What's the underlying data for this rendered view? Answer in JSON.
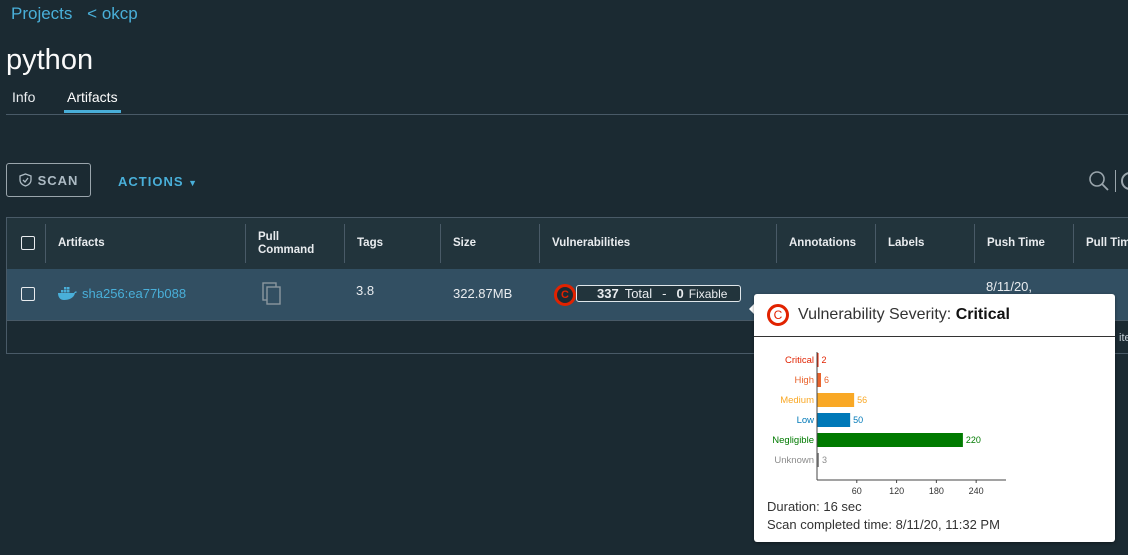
{
  "breadcrumb": {
    "project": "Projects",
    "current": "okcp"
  },
  "page": {
    "title": "python"
  },
  "tabs": [
    {
      "label": "Info"
    },
    {
      "label": "Artifacts"
    }
  ],
  "toolbar": {
    "scan_label": "SCAN",
    "actions_label": "ACTIONS"
  },
  "table": {
    "columns": [
      "Artifacts",
      "Pull Command",
      "Tags",
      "Size",
      "Vulnerabilities",
      "Annotations",
      "Labels",
      "Push Time",
      "Pull Tim"
    ],
    "rows": [
      {
        "digest": "sha256:ea77b088",
        "tags": "3.8",
        "size": "322.87MB",
        "severity_letter": "C",
        "vuln_total": "337",
        "vuln_total_label": "Total",
        "vuln_sep": "-",
        "vuln_fixable": "0",
        "vuln_fixable_label": "Fixable",
        "push_time": "8/11/20,"
      }
    ],
    "footer_fragment": "ite"
  },
  "popover": {
    "title_prefix": "Vulnerability Severity:",
    "title_value": "Critical",
    "badge": "C",
    "duration": "Duration: 16 sec",
    "completed": "Scan completed time: 8/11/20, 11:32 PM"
  },
  "chart_data": {
    "type": "bar",
    "orientation": "horizontal",
    "categories": [
      "Critical",
      "High",
      "Medium",
      "Low",
      "Negligible",
      "Unknown"
    ],
    "values": [
      2,
      6,
      56,
      50,
      220,
      3
    ],
    "colors": [
      "#e12200",
      "#e8632c",
      "#f9a825",
      "#0079b8",
      "#007a00",
      "#8c8c8c"
    ],
    "xticks": [
      60,
      120,
      180,
      240
    ],
    "xlim": [
      0,
      285
    ]
  }
}
